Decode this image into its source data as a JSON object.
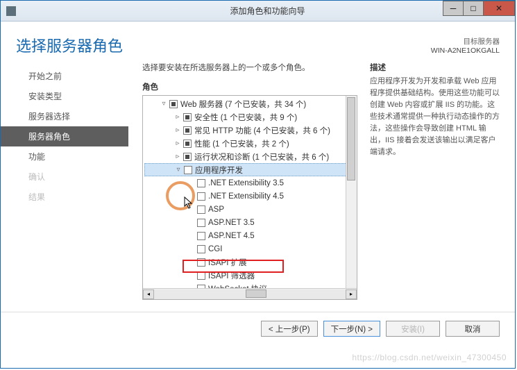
{
  "titlebar": {
    "title": "添加角色和功能向导"
  },
  "header": {
    "page_title": "选择服务器角色",
    "target_label": "目标服务器",
    "target_name": "WIN-A2NE1OKGALL"
  },
  "sidebar": {
    "items": [
      {
        "label": "开始之前",
        "state": "done"
      },
      {
        "label": "安装类型",
        "state": "done"
      },
      {
        "label": "服务器选择",
        "state": "done"
      },
      {
        "label": "服务器角色",
        "state": "active"
      },
      {
        "label": "功能",
        "state": "done"
      },
      {
        "label": "确认",
        "state": "disabled"
      },
      {
        "label": "结果",
        "state": "disabled"
      }
    ]
  },
  "center": {
    "instruction": "选择要安装在所选服务器上的一个或多个角色。",
    "roles_label": "角色",
    "desc_label": "描述",
    "tree": [
      {
        "level": 1,
        "twisty": "▿",
        "check": "partial",
        "label": "Web 服务器 (7 个已安装，共 34 个)"
      },
      {
        "level": 2,
        "twisty": "▹",
        "check": "partial",
        "label": "安全性 (1 个已安装，共 9 个)"
      },
      {
        "level": 2,
        "twisty": "▹",
        "check": "partial",
        "label": "常见 HTTP 功能 (4 个已安装，共 6 个)"
      },
      {
        "level": 2,
        "twisty": "▹",
        "check": "partial",
        "label": "性能 (1 个已安装，共 2 个)"
      },
      {
        "level": 2,
        "twisty": "▹",
        "check": "partial",
        "label": "运行状况和诊断 (1 个已安装，共 6 个)"
      },
      {
        "level": 2,
        "twisty": "▿",
        "check": "none",
        "label": "应用程序开发",
        "selected": true
      },
      {
        "level": 3,
        "twisty": "",
        "check": "none",
        "label": ".NET Extensibility 3.5"
      },
      {
        "level": 3,
        "twisty": "",
        "check": "none",
        "label": ".NET Extensibility 4.5"
      },
      {
        "level": 3,
        "twisty": "",
        "check": "none",
        "label": "ASP"
      },
      {
        "level": 3,
        "twisty": "",
        "check": "none",
        "label": "ASP.NET 3.5"
      },
      {
        "level": 3,
        "twisty": "",
        "check": "none",
        "label": "ASP.NET 4.5"
      },
      {
        "level": 3,
        "twisty": "",
        "check": "none",
        "label": "CGI"
      },
      {
        "level": 3,
        "twisty": "",
        "check": "none",
        "label": "ISAPI 扩展"
      },
      {
        "level": 3,
        "twisty": "",
        "check": "none",
        "label": "ISAPI 筛选器"
      },
      {
        "level": 3,
        "twisty": "",
        "check": "none",
        "label": "WebSocket 协议"
      }
    ]
  },
  "description_panel": {
    "text": "应用程序开发为开发和承载 Web 应用程序提供基础结构。使用这些功能可以创建 Web 内容或扩展 IIS 的功能。这些技术通常提供一种执行动态操作的方法，这些操作会导致创建 HTML 输出，IIS 接着会发送该输出以满足客户端请求。"
  },
  "footer": {
    "prev": "< 上一步(P)",
    "next": "下一步(N) >",
    "install": "安装(I)",
    "cancel": "取消"
  },
  "watermark": "https://blog.csdn.net/weixin_47300450"
}
